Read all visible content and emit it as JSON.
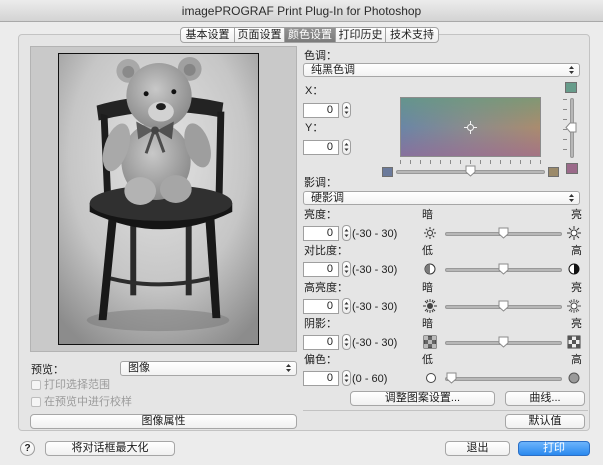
{
  "window": {
    "title": "imagePROGRAF Print Plug-In for Photoshop"
  },
  "tabs": [
    {
      "label": "基本设置",
      "selected": false
    },
    {
      "label": "页面设置",
      "selected": false
    },
    {
      "label": "颜色设置",
      "selected": true
    },
    {
      "label": "打印历史",
      "selected": false
    },
    {
      "label": "技术支持",
      "selected": false
    }
  ],
  "preview": {
    "label": "预览：",
    "mode": "图像",
    "print_selection_label": "打印选择范围",
    "print_selection_checked": false,
    "proof_label": "在预览中进行校样",
    "proof_checked": false,
    "image_properties_button": "图像属性"
  },
  "color_tone": {
    "label": "色调：",
    "value": "纯黑色调",
    "x_label": "X：",
    "x_value": 0,
    "y_label": "Y：",
    "y_value": 0,
    "swatches": {
      "y_plus": "#679c8b",
      "y_minus": "#9b6a8a",
      "x_minus": "#6b7a9b",
      "x_plus": "#9b8a6a"
    }
  },
  "tone": {
    "label": "影调：",
    "value": "硬影调"
  },
  "adjustments": [
    {
      "label": "亮度：",
      "value": 0,
      "min": -30,
      "max": 30,
      "range": "(-30 - 30)",
      "low_label": "暗",
      "high_label": "亮",
      "low_icon": "sun-small-icon",
      "high_icon": "sun-large-icon"
    },
    {
      "label": "对比度：",
      "value": 0,
      "min": -30,
      "max": 30,
      "range": "(-30 - 30)",
      "low_label": "低",
      "high_label": "高",
      "low_icon": "contrast-low-icon",
      "high_icon": "contrast-high-icon"
    },
    {
      "label": "高亮度：",
      "value": 0,
      "min": -30,
      "max": 30,
      "range": "(-30 - 30)",
      "low_label": "暗",
      "high_label": "亮",
      "low_icon": "highlight-dark-icon",
      "high_icon": "highlight-bright-icon"
    },
    {
      "label": "阴影：",
      "value": 0,
      "min": -30,
      "max": 30,
      "range": "(-30 - 30)",
      "low_label": "暗",
      "high_label": "亮",
      "low_icon": "shadow-dark-icon",
      "high_icon": "shadow-bright-icon"
    },
    {
      "label": "偏色：",
      "value": 0,
      "min": 0,
      "max": 60,
      "range": "(0 - 60)",
      "low_label": "低",
      "high_label": "高",
      "low_icon": "hollow-circle-icon",
      "high_icon": "filled-circle-icon"
    }
  ],
  "actions": {
    "adjust_pattern_button": "调整图案设置...",
    "curves_button": "曲线...",
    "defaults_button": "默认值"
  },
  "footer": {
    "help_label": "?",
    "maximize_button": "将对话框最大化",
    "cancel_button": "退出",
    "print_button": "打印"
  },
  "colors": {
    "accent": "#2a89ef"
  }
}
